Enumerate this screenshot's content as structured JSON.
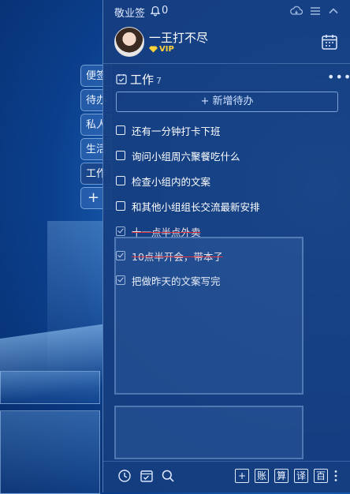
{
  "app": {
    "title": "敬业签",
    "notification_count": "0"
  },
  "user": {
    "name": "一王打不尽",
    "badge": "VIP"
  },
  "side_tabs": [
    {
      "label": "便签"
    },
    {
      "label": "待办"
    },
    {
      "label": "私人"
    },
    {
      "label": "生活"
    },
    {
      "label": "工作",
      "active": true
    },
    {
      "label": "+"
    }
  ],
  "category": {
    "name": "工作",
    "count": "7"
  },
  "add_button": {
    "label": "新增待办"
  },
  "todos": [
    {
      "text": "还有一分钟打卡下班",
      "done": false
    },
    {
      "text": "询问小组周六聚餐吃什么",
      "done": false
    },
    {
      "text": "检查小组内的文案",
      "done": false
    },
    {
      "text": "和其他小组组长交流最新安排",
      "done": false
    },
    {
      "text": "十一点半点外卖",
      "done": true
    },
    {
      "text": "10点半开会，带本子",
      "done": true
    },
    {
      "text": "把做昨天的文案写完",
      "done": true
    }
  ],
  "bottom_toolbar": {
    "boxes": [
      "+",
      "账",
      "算",
      "译",
      "百"
    ]
  },
  "icons": [
    "bell-icon",
    "cloud-icon",
    "menu-icon",
    "collapse-icon",
    "calendar-icon",
    "more-icon",
    "category-check-icon",
    "clock-icon",
    "checklist-icon",
    "search-icon",
    "vertical-more-icon"
  ],
  "colors": {
    "panel": "#153e80",
    "vip": "#ffd23a",
    "strike": "#e0303a"
  }
}
